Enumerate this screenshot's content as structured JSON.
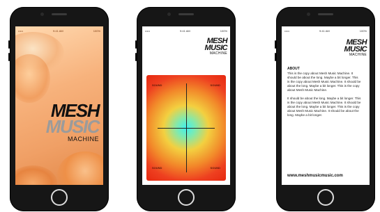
{
  "logo": {
    "line1": "MESH",
    "line2": "MUSIC",
    "line3": "MACHINE"
  },
  "status_bar": {
    "left": "•••••",
    "center": "9:41 AM",
    "right": "100%"
  },
  "pad": {
    "corners": [
      "SOUND",
      "SOUND",
      "SOUND",
      "SOUND"
    ]
  },
  "about": {
    "heading": "ABOUT",
    "paragraph1": "This is the copy about Mesh Music Machine. It should be about the long. Maybe a bit longer. This is the copy about Mesh Music Machine. It should be about the long. Maybe a bit longer. This is the copy about Mesh Music Machine.",
    "paragraph2": "It should be about the long. Maybe a bit longer. This is the copy about Mesh Music Machine. It should be about the long. Maybe a bit longer. This is the copy about Mesh Music Machine. It should be about the long. Maybe a bit longer.",
    "url": "www.meshmusicmusic.com"
  },
  "colors": {
    "phone_body": "#161616",
    "splash_bg": "#f7b27c",
    "pad_outer": "#e62810",
    "pad_center": "#3ff0f0"
  }
}
